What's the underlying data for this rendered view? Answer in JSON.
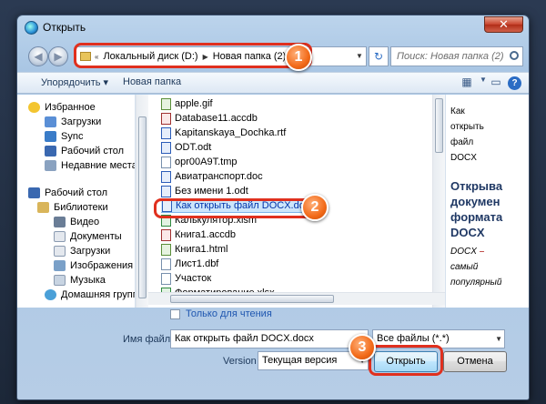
{
  "window": {
    "title": "Открыть",
    "close_label": "✕"
  },
  "address": {
    "crumbs": [
      "Локальный диск (D:)",
      "Новая папка (2)"
    ],
    "back_glyph": "◀",
    "forward_glyph": "▶",
    "refresh_glyph": "↻"
  },
  "search": {
    "placeholder": "Поиск: Новая папка (2)"
  },
  "toolbar": {
    "organize_label": "Упорядочить ▾",
    "new_folder_label": "Новая папка"
  },
  "nav": {
    "favorites": "Избранное",
    "fav_items": [
      "Загрузки",
      "Sync",
      "Рабочий стол",
      "Недавние места"
    ],
    "desktop": "Рабочий стол",
    "libraries": "Библиотеки",
    "lib_items": [
      "Видео",
      "Документы",
      "Загрузки",
      "Изображения",
      "Музыка"
    ],
    "homegroup": "Домашняя группа"
  },
  "files": [
    {
      "name": "apple.gif",
      "type": "img"
    },
    {
      "name": "Database11.accdb",
      "type": "acc"
    },
    {
      "name": "Kapitanskaya_Dochka.rtf",
      "type": "doc"
    },
    {
      "name": "ODT.odt",
      "type": "doc"
    },
    {
      "name": "opr00A9T.tmp",
      "type": "plain"
    },
    {
      "name": "Авиатранспорт.doc",
      "type": "doc"
    },
    {
      "name": "Без имени 1.odt",
      "type": "doc"
    },
    {
      "name": "Как открыть файл DOCX.docx",
      "type": "doc"
    },
    {
      "name": "Калькулятор.xlsm",
      "type": "xls"
    },
    {
      "name": "Книга1.accdb",
      "type": "acc"
    },
    {
      "name": "Книга1.html",
      "type": "img"
    },
    {
      "name": "Лист1.dbf",
      "type": "plain"
    },
    {
      "name": "Участок",
      "type": "plain"
    },
    {
      "name": "Форматирование.xlsx",
      "type": "xls"
    }
  ],
  "selected_file_index": 7,
  "read_only_label": "Только для чтения",
  "preview": {
    "small_lines": [
      "Как",
      "открыть",
      "файл",
      "DOCX"
    ],
    "big_lines": [
      "Открыва",
      "докумен",
      "формата",
      "DOCX"
    ],
    "tail_lines": [
      "DOCX",
      "самый",
      "популярный"
    ]
  },
  "form": {
    "filename_label": "Имя файла:",
    "filename_value": "Как открыть файл DOCX.docx",
    "filetype_value": "Все файлы (*.*)",
    "version_label": "Version",
    "version_value": "Текущая версия",
    "open_label": "Открыть",
    "cancel_label": "Отмена"
  },
  "callouts": [
    "1",
    "2",
    "3"
  ],
  "colors": {
    "accent": "#f26a18",
    "highlight": "#e0301e",
    "selection": "#cde6fb"
  }
}
